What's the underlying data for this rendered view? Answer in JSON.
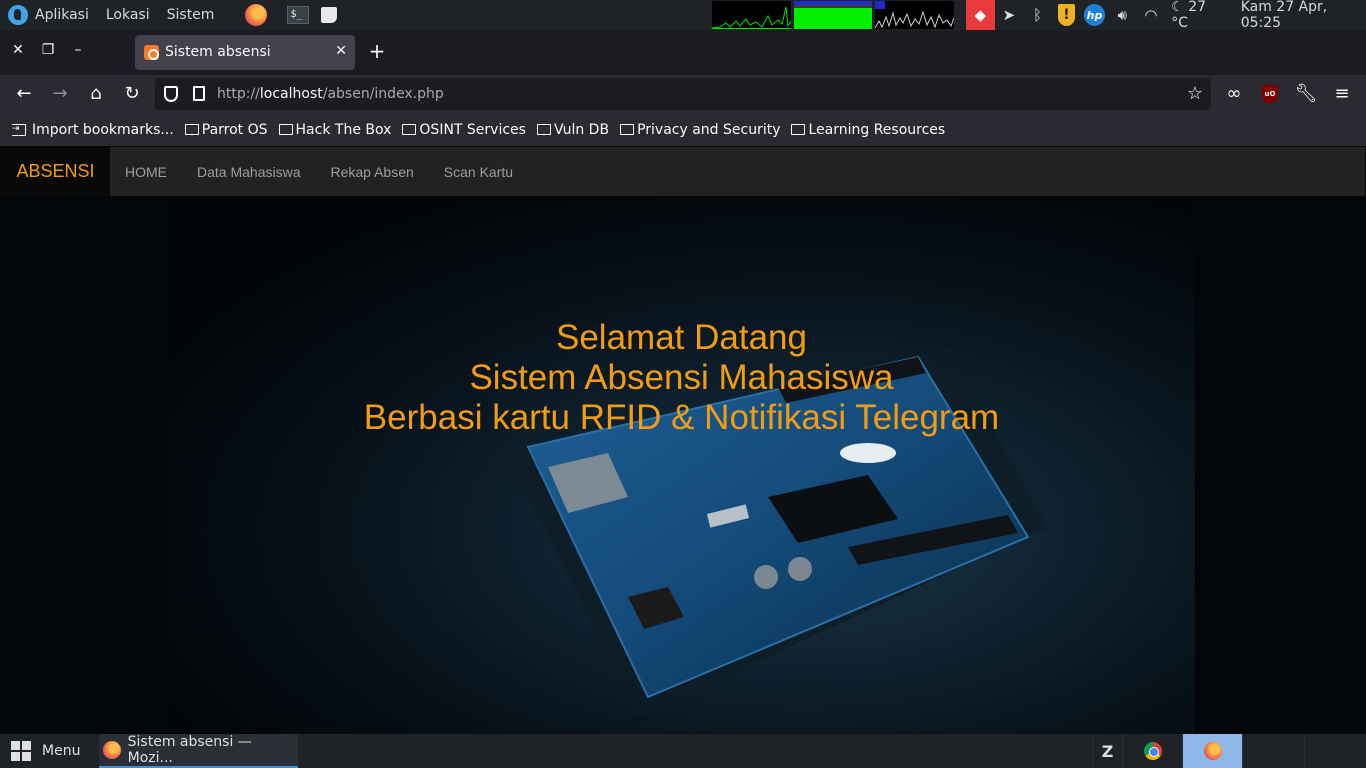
{
  "top_panel": {
    "menus": [
      "Aplikasi",
      "Lokasi",
      "Sistem"
    ],
    "terminal_label": "$_",
    "weather": "27 °C",
    "clock": "Kam 27 Apr, 05:25"
  },
  "browser": {
    "tab_title": "Sistem absensi",
    "url_prefix": "http://",
    "url_host": "localhost",
    "url_path": "/absen/index.php",
    "bookmarks": [
      {
        "label": "Import bookmarks...",
        "icon": "import-icon"
      },
      {
        "label": "Parrot OS",
        "icon": "folder-icon"
      },
      {
        "label": "Hack The Box",
        "icon": "folder-icon"
      },
      {
        "label": "OSINT Services",
        "icon": "folder-icon"
      },
      {
        "label": "Vuln DB",
        "icon": "folder-icon"
      },
      {
        "label": "Privacy and Security",
        "icon": "folder-icon"
      },
      {
        "label": "Learning Resources",
        "icon": "folder-icon"
      }
    ]
  },
  "site": {
    "brand": "ABSENSI",
    "nav": [
      "HOME",
      "Data Mahasiswa",
      "Rekap Absen",
      "Scan Kartu"
    ],
    "hero_lines": [
      "Selamat Datang",
      "Sistem Absensi Mahasiswa",
      "Berbasi kartu RFID & Notifikasi Telegram"
    ],
    "accent_color": "#f39c12"
  },
  "taskbar": {
    "menu_label": "Menu",
    "task_label": "Sistem absensi — Mozi..."
  }
}
